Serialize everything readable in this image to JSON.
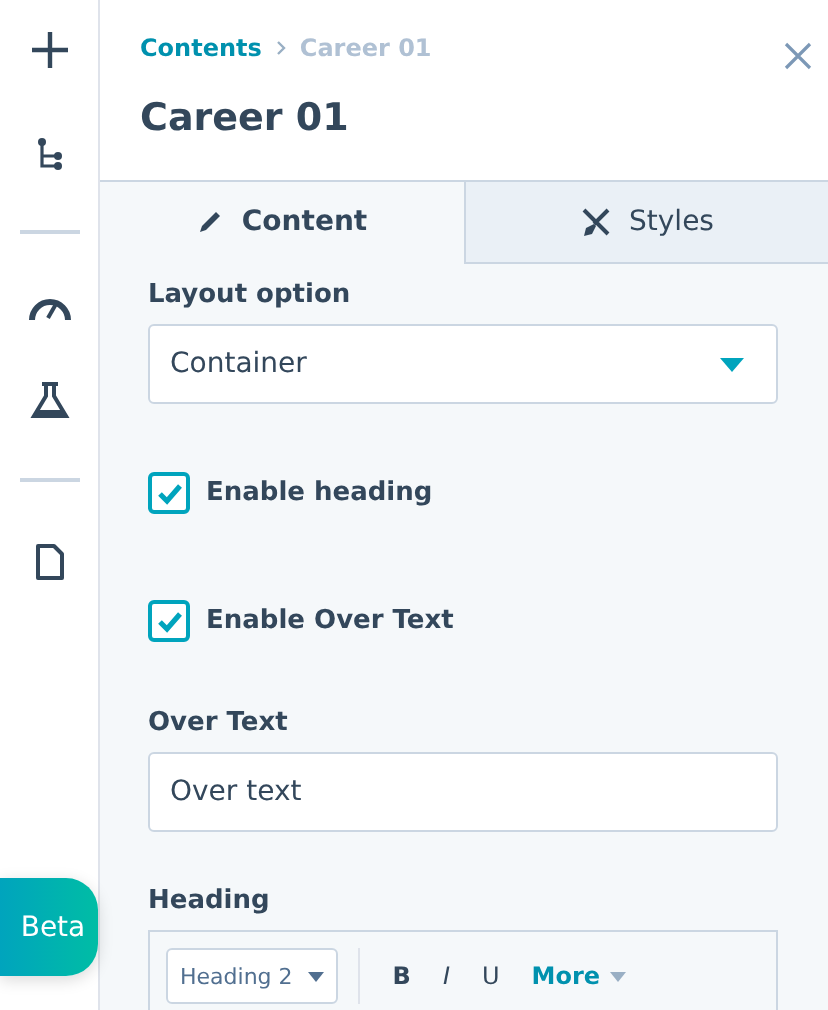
{
  "rail": {
    "items": [
      {
        "kind": "add"
      },
      {
        "kind": "tree"
      },
      {
        "kind": "divider"
      },
      {
        "kind": "gauge"
      },
      {
        "kind": "flask"
      },
      {
        "kind": "divider"
      },
      {
        "kind": "page"
      }
    ],
    "beta": "Beta"
  },
  "breadcrumb": [
    "Contents",
    "Career 01"
  ],
  "title": "Career 01",
  "tabs": [
    {
      "label": "Content",
      "kind": "pencil",
      "selected": true
    },
    {
      "label": "Styles",
      "kind": "brush",
      "selected": false
    }
  ],
  "layout_option": {
    "label": "Layout option",
    "value": "Container"
  },
  "checkboxes": [
    {
      "label": "Enable heading",
      "checked": true
    },
    {
      "label": "Enable Over Text",
      "checked": true
    }
  ],
  "over_text": {
    "label": "Over Text",
    "value": "Over text"
  },
  "heading": {
    "label": "Heading",
    "style": "Heading 2",
    "buttons": [
      "B",
      "I",
      "U"
    ],
    "more": "More"
  }
}
